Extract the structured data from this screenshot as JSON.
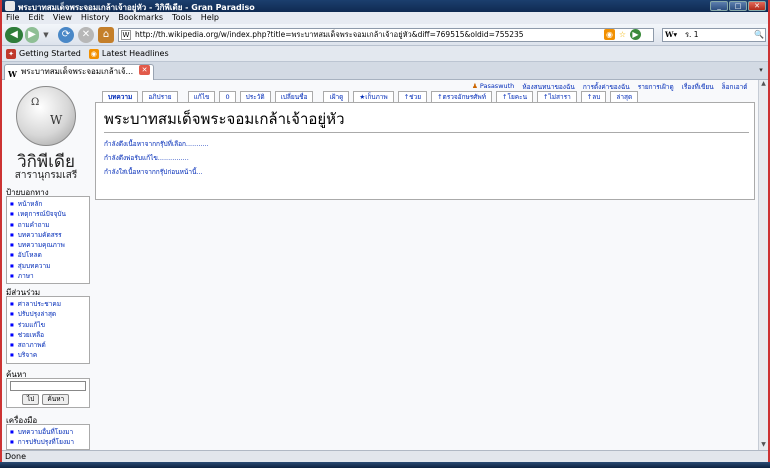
{
  "window": {
    "title": "พระบาทสมเด็จพระจอมเกล้าเจ้าอยู่หัว - วิกิพีเดีย - Gran Paradiso"
  },
  "window_buttons": [
    "_",
    "□",
    "✕"
  ],
  "menu": [
    "File",
    "Edit",
    "View",
    "History",
    "Bookmarks",
    "Tools",
    "Help"
  ],
  "nav": {
    "back": "◀",
    "forward": "▶",
    "history_drop": "▼",
    "reload": "⟳",
    "stop": "✕",
    "home": "⌂",
    "url": "http://th.wikipedia.org/w/index.php?title=พระบาทสมเด็จพระจอมเกล้าเจ้าอยู่หัว&diff=769515&oldid=755235",
    "url_favicon": "W",
    "search_value": "ร. 1",
    "search_engine": "W▾",
    "search_go": "🔍",
    "icons": [
      "rss-icon",
      "star-icon",
      "go-icon"
    ]
  },
  "bookmarks": [
    {
      "label": "Getting Started",
      "icon": "getting-started-icon"
    },
    {
      "label": "Latest Headlines",
      "icon": "rss-icon"
    }
  ],
  "tab": {
    "label": "พระบาทสมเด็จพระจอมเกล้าเจ้...",
    "favicon": "W",
    "close": "✕",
    "scroll": "▾"
  },
  "wiki": {
    "logo_title": "วิกิพีเดีย",
    "logo_subtitle": "สารานุกรมเสรี",
    "globe_glyphs": [
      "Ω",
      "W"
    ],
    "personal": [
      "Pasaswuth",
      "ห้องสนทนาของฉัน",
      "การตั้งค่าของฉัน",
      "รายการเฝ้าดู",
      "เรื่องที่เขียน",
      "ล็อกเอาต์"
    ],
    "tabs": [
      "บทความ",
      "อภิปราย",
      "แก้ไข",
      "0",
      "ประวัติ",
      "เปลี่ยนชื่อ",
      "เฝ้าดู",
      "★เก็บภาพ",
      "↑ช่วย",
      "↑ตรวจอักษรศัพท์",
      "↑โยคะน",
      "↑ไม่สารา",
      "↑ลบ",
      "ล่าสุด"
    ],
    "page_title": "พระบาทสมเด็จพระจอมเกล้าเจ้าอยู่หัว",
    "content_links": [
      "กำลังดึงเนื้อหาจากกรุ๊ปที่เลือก...........",
      "กำลังดึงพ่อรับแก้ไข...............",
      "กำลังใส่เนื้อหาจากกรุ๊ปก่อนหน้านี้..."
    ],
    "nav_header": "ป้ายบอกทาง",
    "nav_items": [
      "หน้าหลัก",
      "เหตุการณ์ปัจจุบัน",
      "ถามคำถาม",
      "บทความคัดสรร",
      "บทความคุณภาพ",
      "อัปโหลด",
      "สุ่มบทความ",
      "ภาษา"
    ],
    "interact_header": "มีส่วนร่วม",
    "interact_items": [
      "ศาลาประชาคม",
      "ปรับปรุงล่าสุด",
      "ร่วมแก้ไข",
      "ช่วยเหลือ",
      "สถาภาพต์",
      "บริจาค"
    ],
    "search_header": "ค้นหา",
    "search_go": "ไป",
    "search_button": "ค้นหา",
    "tools_header": "เครื่องมือ",
    "tools_items": [
      "บทความอื่นที่โยงมา",
      "การปรับปรุงที่โยงมา"
    ]
  },
  "status": "Done"
}
